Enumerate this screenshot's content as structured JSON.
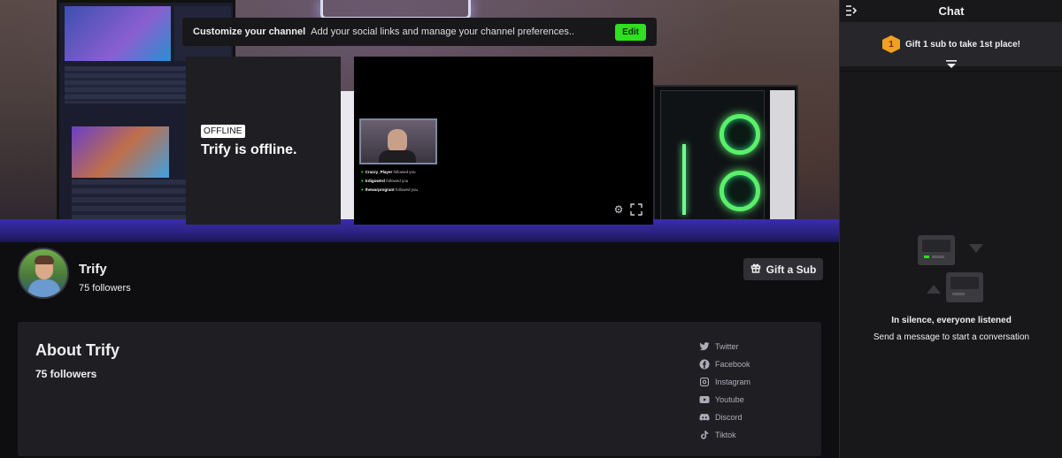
{
  "customize_bar": {
    "title": "Customize your channel",
    "text": "Add your social links and manage your channel preferences..",
    "edit_label": "Edit",
    "edit_color": "#2de020"
  },
  "stream": {
    "offline_badge": "OFFLINE",
    "offline_text": "Trify is offline.",
    "feed": [
      {
        "user": "Crazzy_Player",
        "text": "followed you"
      },
      {
        "user": "trdigowtrd",
        "text": "followed you"
      },
      {
        "user": "thewarprogrant",
        "text": "followed you"
      }
    ],
    "settings_icon": "settings-icon",
    "fullscreen_icon": "fullscreen-icon"
  },
  "channel": {
    "name": "Trify",
    "followers": "75 followers",
    "gift_sub_label": "Gift a Sub",
    "gift_icon": "gift-icon"
  },
  "about": {
    "title": "About Trify",
    "followers": "75 followers",
    "socials": [
      {
        "label": "Twitter",
        "icon": "twitter-icon"
      },
      {
        "label": "Facebook",
        "icon": "facebook-icon"
      },
      {
        "label": "Instagram",
        "icon": "instagram-icon"
      },
      {
        "label": "Youtube",
        "icon": "youtube-icon"
      },
      {
        "label": "Discord",
        "icon": "discord-icon"
      },
      {
        "label": "Tiktok",
        "icon": "tiktok-icon"
      }
    ]
  },
  "chat": {
    "title": "Chat",
    "gift_banner": "Gift 1 sub to take 1st place!",
    "gift_badge": "1",
    "empty_title": "In silence, everyone listened",
    "empty_subtitle": "Send a message to start a conversation",
    "collapse_icon": "collapse-icon",
    "expand_icon": "chevron-down-icon"
  },
  "colors": {
    "background": "#0e0e10",
    "panel": "#1f1f23",
    "chat_bg": "#18181b",
    "text": "#efeff1",
    "muted": "#adadb8"
  }
}
